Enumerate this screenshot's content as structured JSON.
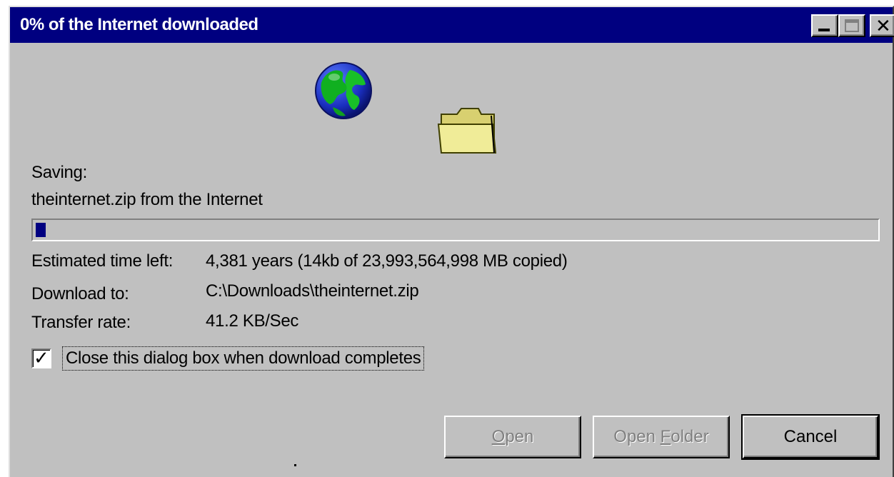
{
  "window": {
    "title": "0% of the Internet downloaded",
    "controls": {
      "minimize": "minimize",
      "maximize": "maximize",
      "close": "close"
    }
  },
  "icons": {
    "globe": "globe-icon",
    "folder": "folder-icon"
  },
  "status": {
    "saving_label": "Saving:",
    "file_source": "theinternet.zip from the Internet",
    "progress_percent": 0
  },
  "details": {
    "time_left_label": "Estimated time left:",
    "time_left_value": "4,381 years (14kb of 23,993,564,998 MB copied)",
    "download_to_label": "Download to:",
    "download_to_value": "C:\\Downloads\\theinternet.zip",
    "transfer_rate_label": "Transfer rate:",
    "transfer_rate_value": "41.2 KB/Sec"
  },
  "close_checkbox": {
    "label": "Close this dialog box when download completes",
    "checked": true
  },
  "buttons": {
    "open": {
      "label_u": "O",
      "label_rest": "pen",
      "enabled": false
    },
    "open_folder": {
      "label_pre": "Open ",
      "label_u": "F",
      "label_rest": "older",
      "enabled": false
    },
    "cancel": {
      "label": "Cancel",
      "enabled": true
    }
  },
  "colors": {
    "titlebar": "#000080",
    "face": "#c0c0c0",
    "progress_fill": "#000080"
  }
}
